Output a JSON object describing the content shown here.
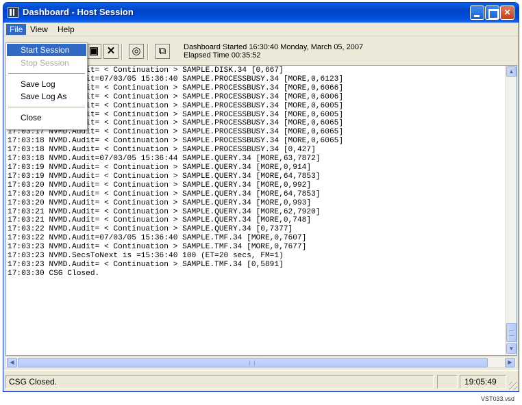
{
  "window": {
    "title": "Dashboard - Host Session",
    "icon": "grid-app-icon"
  },
  "menubar": {
    "file": "File",
    "view": "View",
    "help": "Help"
  },
  "file_menu": {
    "items": [
      "Start Session",
      "Stop Session",
      "Save Log",
      "Save Log As",
      "Close"
    ],
    "disabled": [
      "Stop Session"
    ],
    "highlighted": "Start Session"
  },
  "toolbar": {
    "icons": [
      "disk-icon",
      "delete-icon",
      "globe-icon",
      "properties-icon"
    ],
    "status_line1": "Dashboard Started 16:30:40 Monday, March 05, 2007",
    "status_line2": "Elapsed Time 00:35:52"
  },
  "log": {
    "lines": [
      "17:03:16 NVMD.Audit= < Continuation > SAMPLE.DISK.34 [0,667]",
      "17:03:16 NVMD.Audit=07/03/05 15:36:40 SAMPLE.PROCESSBUSY.34 [MORE,0,6123]",
      "17:03:16 NVMD.Audit= < Continuation > SAMPLE.PROCESSBUSY.34 [MORE,0,6066]",
      "17:03:16 NVMD.Audit= < Continuation > SAMPLE.PROCESSBUSY.34 [MORE,0,6006]",
      "17:03:16 NVMD.Audit= < Continuation > SAMPLE.PROCESSBUSY.34 [MORE,0,6005]",
      "17:03:16 NVMD.Audit= < Continuation > SAMPLE.PROCESSBUSY.34 [MORE,0,6005]",
      "17:03:17 NVMD.Audit= < Continuation > SAMPLE.PROCESSBUSY.34 [MORE,0,6065]",
      "17:03:17 NVMD.Audit= < Continuation > SAMPLE.PROCESSBUSY.34 [MORE,0,6065]",
      "17:03:18 NVMD.Audit= < Continuation > SAMPLE.PROCESSBUSY.34 [MORE,0,6065]",
      "17:03:18 NVMD.Audit= < Continuation > SAMPLE.PROCESSBUSY.34 [0,427]",
      "17:03:18 NVMD.Audit=07/03/05 15:36:44 SAMPLE.QUERY.34 [MORE,63,7872]",
      "17:03:19 NVMD.Audit= < Continuation > SAMPLE.QUERY.34 [MORE,0,914]",
      "17:03:19 NVMD.Audit= < Continuation > SAMPLE.QUERY.34 [MORE,64,7853]",
      "17:03:20 NVMD.Audit= < Continuation > SAMPLE.QUERY.34 [MORE,0,992]",
      "17:03:20 NVMD.Audit= < Continuation > SAMPLE.QUERY.34 [MORE,64,7853]",
      "17:03:20 NVMD.Audit= < Continuation > SAMPLE.QUERY.34 [MORE,0,993]",
      "17:03:21 NVMD.Audit= < Continuation > SAMPLE.QUERY.34 [MORE,62,7920]",
      "17:03:21 NVMD.Audit= < Continuation > SAMPLE.QUERY.34 [MORE,0,748]",
      "17:03:22 NVMD.Audit= < Continuation > SAMPLE.QUERY.34 [0,7377]",
      "17:03:22 NVMD.Audit=07/03/05 15:36:40 SAMPLE.TMF.34 [MORE,0,7607]",
      "17:03:23 NVMD.Audit= < Continuation > SAMPLE.TMF.34 [MORE,0,7677]",
      "17:03:23 NVMD.SecsToNext is =15:36:40 100 (ET=20 secs, FM=1)",
      "17:03:23 NVMD.Audit= < Continuation > SAMPLE.TMF.34 [0,5891]",
      "17:03:30 CSG Closed."
    ]
  },
  "statusbar": {
    "message": "CSG Closed.",
    "clock": "19:05:49"
  },
  "footer": {
    "tag": "VST033.vsd"
  }
}
